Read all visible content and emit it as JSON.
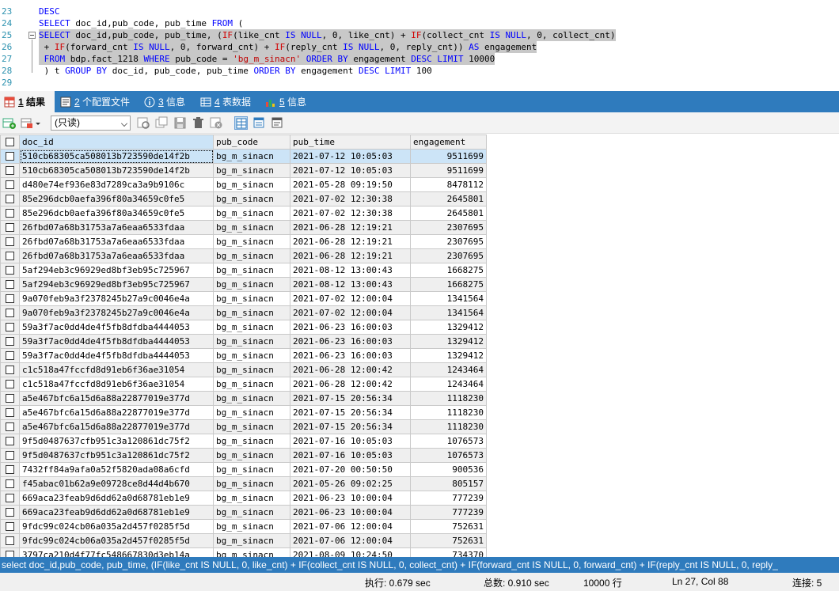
{
  "editor": {
    "lines": [
      {
        "n": "23",
        "parts": [
          {
            "t": "DESC",
            "c": "kw"
          }
        ]
      },
      {
        "n": "24",
        "parts": [
          {
            "t": "SELECT",
            "c": "kw"
          },
          {
            "t": " doc_id,pub_code, pub_time ",
            "c": ""
          },
          {
            "t": "FROM",
            "c": "kw"
          },
          {
            "t": " (",
            "c": ""
          }
        ]
      },
      {
        "n": "25",
        "parts": [
          {
            "t": "SELECT",
            "c": "kw"
          },
          {
            "t": " doc_id,pub_code, pub_time, (",
            "c": ""
          },
          {
            "t": "IF",
            "c": "fn"
          },
          {
            "t": "(like_cnt ",
            "c": ""
          },
          {
            "t": "IS NULL",
            "c": "kw"
          },
          {
            "t": ", 0, like_cnt) + ",
            "c": ""
          },
          {
            "t": "IF",
            "c": "fn"
          },
          {
            "t": "(collect_cnt ",
            "c": ""
          },
          {
            "t": "IS NULL",
            "c": "kw"
          },
          {
            "t": ", 0, collect_cnt)",
            "c": ""
          }
        ]
      },
      {
        "n": "26",
        "parts": [
          {
            "t": " + ",
            "c": ""
          },
          {
            "t": "IF",
            "c": "fn"
          },
          {
            "t": "(forward_cnt ",
            "c": ""
          },
          {
            "t": "IS NULL",
            "c": "kw"
          },
          {
            "t": ", 0, forward_cnt) + ",
            "c": ""
          },
          {
            "t": "IF",
            "c": "fn"
          },
          {
            "t": "(reply_cnt ",
            "c": ""
          },
          {
            "t": "IS NULL",
            "c": "kw"
          },
          {
            "t": ", 0, reply_cnt)) ",
            "c": ""
          },
          {
            "t": "AS",
            "c": "kw"
          },
          {
            "t": " engagement",
            "c": ""
          }
        ]
      },
      {
        "n": "27",
        "parts": [
          {
            "t": " FROM",
            "c": "kw"
          },
          {
            "t": " bdp.fact_1218 ",
            "c": ""
          },
          {
            "t": "WHERE",
            "c": "kw"
          },
          {
            "t": " pub_code = ",
            "c": ""
          },
          {
            "t": "'bg_m_sinacn'",
            "c": "str"
          },
          {
            "t": " ",
            "c": ""
          },
          {
            "t": "ORDER BY",
            "c": "kw"
          },
          {
            "t": " engagement ",
            "c": ""
          },
          {
            "t": "DESC LIMIT",
            "c": "kw"
          },
          {
            "t": " 10000",
            "c": ""
          }
        ]
      },
      {
        "n": "28",
        "parts": [
          {
            "t": " ) t ",
            "c": ""
          },
          {
            "t": "GROUP BY",
            "c": "kw"
          },
          {
            "t": " doc_id, pub_code, pub_time ",
            "c": ""
          },
          {
            "t": "ORDER BY",
            "c": "kw"
          },
          {
            "t": " engagement ",
            "c": ""
          },
          {
            "t": "DESC LIMIT",
            "c": "kw"
          },
          {
            "t": " 100",
            "c": ""
          }
        ]
      },
      {
        "n": "29",
        "parts": []
      }
    ]
  },
  "tabs": [
    {
      "num": "1",
      "label": " 结果",
      "icon": "result-table-icon"
    },
    {
      "num": "2",
      "label": " 个配置文件",
      "icon": "profile-icon"
    },
    {
      "num": "3",
      "label": " 信息",
      "icon": "info-icon"
    },
    {
      "num": "4",
      "label": " 表数据",
      "icon": "table-data-icon"
    },
    {
      "num": "5",
      "label": " 信息",
      "icon": "info-chart-icon"
    }
  ],
  "toolbar": {
    "mode": "(只读)"
  },
  "grid": {
    "columns": [
      "doc_id",
      "pub_code",
      "pub_time",
      "engagement"
    ],
    "rows": [
      [
        "510cb68305ca508013b723590de14f2b",
        "bg_m_sinacn",
        "2021-07-12 10:05:03",
        "9511699"
      ],
      [
        "510cb68305ca508013b723590de14f2b",
        "bg_m_sinacn",
        "2021-07-12 10:05:03",
        "9511699"
      ],
      [
        "d480e74ef936e83d7289ca3a9b9106c",
        "bg_m_sinacn",
        "2021-05-28 09:19:50",
        "8478112"
      ],
      [
        "85e296dcb0aefa396f80a34659c0fe5",
        "bg_m_sinacn",
        "2021-07-02 12:30:38",
        "2645801"
      ],
      [
        "85e296dcb0aefa396f80a34659c0fe5",
        "bg_m_sinacn",
        "2021-07-02 12:30:38",
        "2645801"
      ],
      [
        "26fbd07a68b31753a7a6eaa6533fdaa",
        "bg_m_sinacn",
        "2021-06-28 12:19:21",
        "2307695"
      ],
      [
        "26fbd07a68b31753a7a6eaa6533fdaa",
        "bg_m_sinacn",
        "2021-06-28 12:19:21",
        "2307695"
      ],
      [
        "26fbd07a68b31753a7a6eaa6533fdaa",
        "bg_m_sinacn",
        "2021-06-28 12:19:21",
        "2307695"
      ],
      [
        "5af294eb3c96929ed8bf3eb95c725967",
        "bg_m_sinacn",
        "2021-08-12 13:00:43",
        "1668275"
      ],
      [
        "5af294eb3c96929ed8bf3eb95c725967",
        "bg_m_sinacn",
        "2021-08-12 13:00:43",
        "1668275"
      ],
      [
        "9a070feb9a3f2378245b27a9c0046e4a",
        "bg_m_sinacn",
        "2021-07-02 12:00:04",
        "1341564"
      ],
      [
        "9a070feb9a3f2378245b27a9c0046e4a",
        "bg_m_sinacn",
        "2021-07-02 12:00:04",
        "1341564"
      ],
      [
        "59a3f7ac0dd4de4f5fb8dfdba4444053",
        "bg_m_sinacn",
        "2021-06-23 16:00:03",
        "1329412"
      ],
      [
        "59a3f7ac0dd4de4f5fb8dfdba4444053",
        "bg_m_sinacn",
        "2021-06-23 16:00:03",
        "1329412"
      ],
      [
        "59a3f7ac0dd4de4f5fb8dfdba4444053",
        "bg_m_sinacn",
        "2021-06-23 16:00:03",
        "1329412"
      ],
      [
        "c1c518a47fccfd8d91eb6f36ae31054",
        "bg_m_sinacn",
        "2021-06-28 12:00:42",
        "1243464"
      ],
      [
        "c1c518a47fccfd8d91eb6f36ae31054",
        "bg_m_sinacn",
        "2021-06-28 12:00:42",
        "1243464"
      ],
      [
        "a5e467bfc6a15d6a88a22877019e377d",
        "bg_m_sinacn",
        "2021-07-15 20:56:34",
        "1118230"
      ],
      [
        "a5e467bfc6a15d6a88a22877019e377d",
        "bg_m_sinacn",
        "2021-07-15 20:56:34",
        "1118230"
      ],
      [
        "a5e467bfc6a15d6a88a22877019e377d",
        "bg_m_sinacn",
        "2021-07-15 20:56:34",
        "1118230"
      ],
      [
        "9f5d0487637cfb951c3a120861dc75f2",
        "bg_m_sinacn",
        "2021-07-16 10:05:03",
        "1076573"
      ],
      [
        "9f5d0487637cfb951c3a120861dc75f2",
        "bg_m_sinacn",
        "2021-07-16 10:05:03",
        "1076573"
      ],
      [
        "7432ff84a9afa0a52f5820ada08a6cfd",
        "bg_m_sinacn",
        "2021-07-20 00:50:50",
        "900536"
      ],
      [
        "f45abac01b62a9e09728ce8d44d4b670",
        "bg_m_sinacn",
        "2021-05-26 09:02:25",
        "805157"
      ],
      [
        "669aca23feab9d6dd62a0d68781eb1e9",
        "bg_m_sinacn",
        "2021-06-23 10:00:04",
        "777239"
      ],
      [
        "669aca23feab9d6dd62a0d68781eb1e9",
        "bg_m_sinacn",
        "2021-06-23 10:00:04",
        "777239"
      ],
      [
        "9fdc99c024cb06a035a2d457f0285f5d",
        "bg_m_sinacn",
        "2021-07-06 12:00:04",
        "752631"
      ],
      [
        "9fdc99c024cb06a035a2d457f0285f5d",
        "bg_m_sinacn",
        "2021-07-06 12:00:04",
        "752631"
      ],
      [
        "3797ca210d4f77fc548667830d3eb14a",
        "bg_m_sinacn",
        "2021-08-09 10:24:50",
        "734370"
      ]
    ]
  },
  "sqlbar": {
    "text": "select doc_id,pub_code, pub_time, (IF(like_cnt IS NULL, 0, like_cnt) + IF(collect_cnt IS NULL, 0, collect_cnt) + IF(forward_cnt IS NULL, 0, forward_cnt) + IF(reply_cnt IS NULL, 0, reply_"
  },
  "status": {
    "exec": "执行: 0.679 sec",
    "total": "总数: 0.910 sec",
    "rows": "10000 行",
    "pos": "Ln 27, Col 88",
    "conn": "连接: 5"
  }
}
